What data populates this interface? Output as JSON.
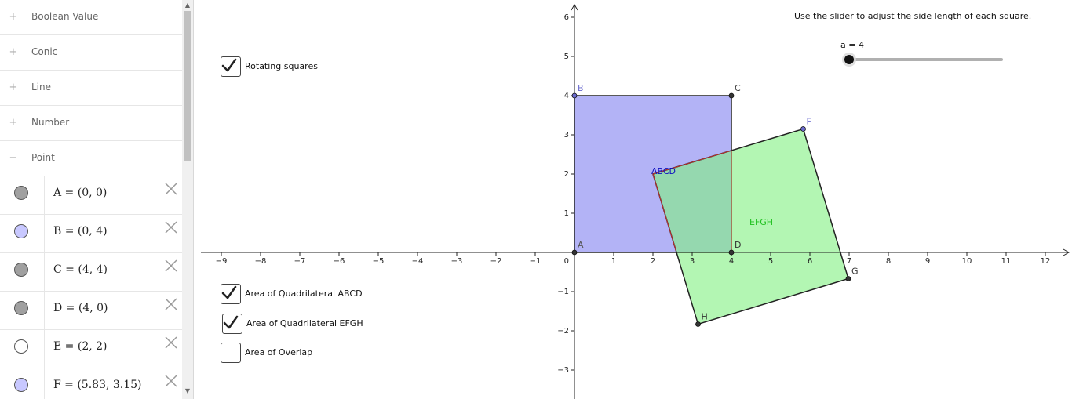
{
  "algebra_view": {
    "categories": [
      {
        "label": "Boolean Value",
        "toggle": "+",
        "expanded": false
      },
      {
        "label": "Conic",
        "toggle": "+",
        "expanded": false
      },
      {
        "label": "Line",
        "toggle": "+",
        "expanded": false
      },
      {
        "label": "Number",
        "toggle": "+",
        "expanded": false
      },
      {
        "label": "Point",
        "toggle": "−",
        "expanded": true
      }
    ],
    "points": [
      {
        "definition": "A = (0, 0)",
        "marble_color": "#a0a0a0"
      },
      {
        "definition": "B = (0, 4)",
        "marble_color": "#c8c8ff"
      },
      {
        "definition": "C = (4, 4)",
        "marble_color": "#a0a0a0"
      },
      {
        "definition": "D = (4, 0)",
        "marble_color": "#a0a0a0"
      },
      {
        "definition": "E = (2, 2)",
        "marble_color": "#ffffff"
      },
      {
        "definition": "F = (5.83, 3.15)",
        "marble_color": "#c8c8ff"
      }
    ],
    "delete_icon": "close-icon"
  },
  "graphics": {
    "instruction": "Use the slider to adjust the side length of each square.",
    "slider": {
      "label": "a = 4",
      "value": 4,
      "min": 4,
      "max": 20
    },
    "checkboxes": [
      {
        "label": "Rotating squares",
        "checked": true
      },
      {
        "label": "Area of Quadrilateral ABCD",
        "checked": true
      },
      {
        "label": "Area of Quadrilateral EFGH",
        "checked": true
      },
      {
        "label": "Area of Overlap",
        "checked": false
      }
    ],
    "axes": {
      "x_range": [
        -9.4,
        12.6
      ],
      "y_range": [
        -3.7,
        6.3
      ],
      "x_ticks": [
        "−9",
        "−8",
        "−7",
        "−6",
        "−5",
        "−4",
        "−3",
        "−2",
        "−1",
        "1",
        "2",
        "3",
        "4",
        "5",
        "6",
        "7",
        "8",
        "9",
        "10",
        "11",
        "12"
      ],
      "x_tick_values": [
        -9,
        -8,
        -7,
        -6,
        -5,
        -4,
        -3,
        -2,
        -1,
        1,
        2,
        3,
        4,
        5,
        6,
        7,
        8,
        9,
        10,
        11,
        12
      ],
      "y_ticks": [
        "−3",
        "−2",
        "−1",
        "1",
        "2",
        "3",
        "4",
        "5",
        "6"
      ],
      "y_tick_values": [
        -3,
        -2,
        -1,
        1,
        2,
        3,
        4,
        5,
        6
      ],
      "origin_label": "0"
    },
    "points": [
      {
        "name": "A",
        "x": 0,
        "y": 0,
        "color": "#333333",
        "label_color": "#555555"
      },
      {
        "name": "B",
        "x": 0,
        "y": 4,
        "color": "#6b6bcf",
        "label_color": "#6b6bcf"
      },
      {
        "name": "C",
        "x": 4,
        "y": 4,
        "color": "#333333",
        "label_color": "#333333"
      },
      {
        "name": "D",
        "x": 4,
        "y": 0,
        "color": "#333333",
        "label_color": "#333333"
      },
      {
        "name": "F",
        "x": 5.83,
        "y": 3.15,
        "color": "#6b6bcf",
        "label_color": "#6b6bcf"
      },
      {
        "name": "G",
        "x": 6.98,
        "y": -0.67,
        "color": "#333333",
        "label_color": "#333333"
      },
      {
        "name": "H",
        "x": 3.15,
        "y": -1.83,
        "color": "#333333",
        "label_color": "#333333"
      }
    ],
    "polygons": [
      {
        "name": "ABCD",
        "vertices": [
          [
            0,
            0
          ],
          [
            0,
            4
          ],
          [
            4,
            4
          ],
          [
            4,
            0
          ]
        ],
        "fill": "#8080f0",
        "stroke": "#222222",
        "label": "ABCD",
        "label_color": "#1010c0",
        "label_at": [
          2,
          2
        ]
      },
      {
        "name": "EFGH",
        "vertices": [
          [
            2,
            2
          ],
          [
            5.83,
            3.15
          ],
          [
            6.98,
            -0.67
          ],
          [
            3.15,
            -1.83
          ]
        ],
        "fill": "#80f080",
        "stroke": "#222222",
        "label": "EFGH",
        "label_color": "#20c020",
        "label_at": [
          4.5,
          0.7
        ]
      }
    ],
    "overlap": {
      "vertices": [
        [
          2,
          2
        ],
        [
          4,
          2.6
        ],
        [
          4,
          0
        ],
        [
          2.6,
          0
        ]
      ],
      "stroke": "#c03030"
    }
  }
}
